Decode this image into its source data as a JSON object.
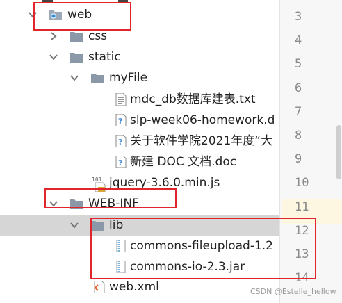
{
  "tree": {
    "items": [
      {
        "label": "web",
        "kind": "web-folder"
      },
      {
        "label": "css",
        "kind": "folder"
      },
      {
        "label": "static",
        "kind": "folder"
      },
      {
        "label": "myFile",
        "kind": "folder"
      },
      {
        "label": "mdc_db数据库建表.txt",
        "kind": "text-file"
      },
      {
        "label": "slp-week06-homework.d",
        "kind": "unknown-file"
      },
      {
        "label": "关于软件学院2021年度“大",
        "kind": "unknown-file"
      },
      {
        "label": "新建 DOC 文档.doc",
        "kind": "unknown-file"
      },
      {
        "label": "jquery-3.6.0.min.js",
        "kind": "js-file",
        "badge": "101"
      },
      {
        "label": "WEB-INF",
        "kind": "folder"
      },
      {
        "label": "lib",
        "kind": "folder",
        "selected": true
      },
      {
        "label": "commons-fileupload-1.2",
        "kind": "jar-file"
      },
      {
        "label": "commons-io-2.3.jar",
        "kind": "jar-file"
      },
      {
        "label": "web.xml",
        "kind": "xml-file"
      }
    ]
  },
  "gutter": {
    "line_numbers": [
      "3",
      "4",
      "5",
      "6",
      "7",
      "8",
      "9",
      "10",
      "11",
      "12",
      "13",
      "14"
    ],
    "highlighted_line": "11"
  },
  "watermark": "CSDN @Estelle_hellow",
  "colors": {
    "annotation_box": "#e0262b",
    "folder": "#8a98a8",
    "selected_row": "#d6d6d6"
  }
}
